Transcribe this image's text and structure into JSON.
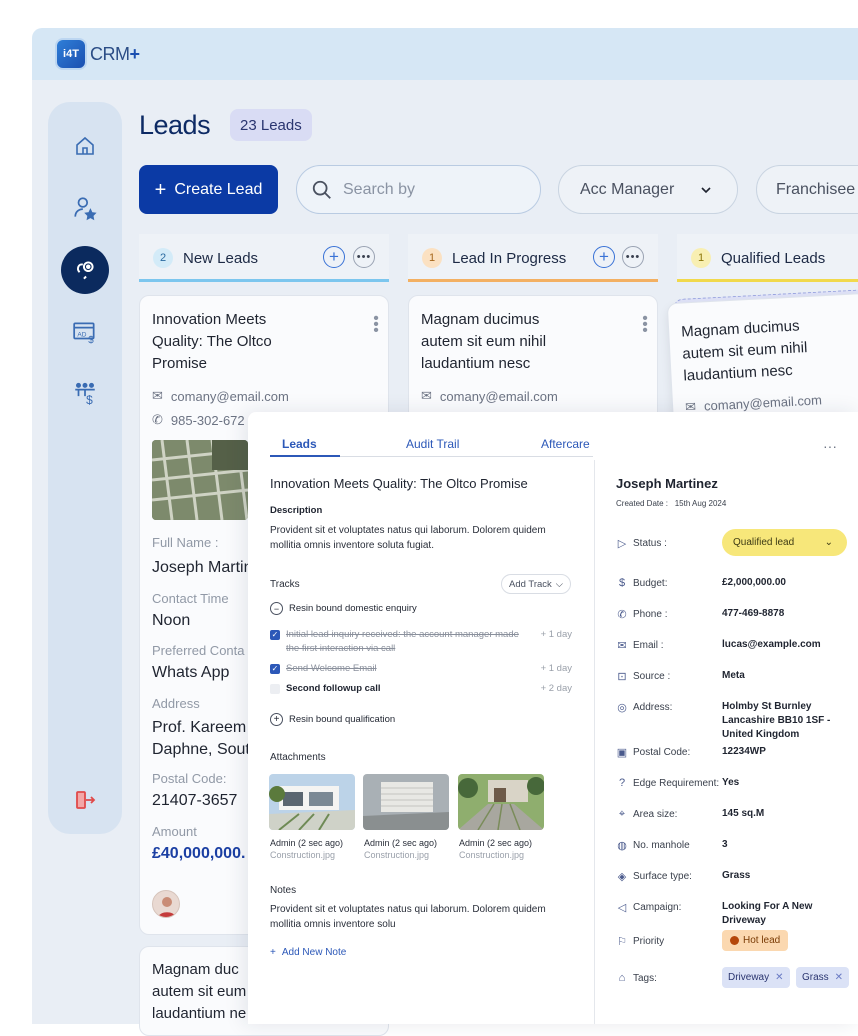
{
  "app": {
    "logo_text": "i4T",
    "name": "CRM",
    "plus": "+"
  },
  "sidebar": {
    "items": [
      "home-icon",
      "user-star-icon",
      "leads-icon",
      "ads-dollar-icon",
      "franchise-dollar-icon"
    ],
    "logout": "logout-icon"
  },
  "header": {
    "title": "Leads",
    "badge": "23 Leads"
  },
  "toolbar": {
    "create_label": "Create Lead",
    "search_placeholder": "Search by",
    "acc_manager": "Acc Manager",
    "franchisee": "Franchisee"
  },
  "columns": [
    {
      "count": "2",
      "title": "New Leads",
      "color": "#7cc6ee"
    },
    {
      "count": "1",
      "title": "Lead In Progress",
      "color": "#f3b062"
    },
    {
      "count": "1",
      "title": "Qualified Leads",
      "color": "#f1d94c"
    }
  ],
  "cards": {
    "new_1": {
      "title_lines": [
        "Innovation Meets",
        "Quality: The Oltco",
        "Promise"
      ],
      "email": "comany@email.com",
      "phone": "985-302-672",
      "full_name_label": "Full Name :",
      "full_name": "Joseph Martin",
      "contact_time_label": "Contact Time",
      "contact_time": "Noon",
      "preferred_label": "Preferred Conta",
      "preferred": "Whats App",
      "address_label": "Address",
      "address_lines": [
        "Prof. Kareem",
        "Daphne, Sout"
      ],
      "postal_label": "Postal Code:",
      "postal": "21407-3657",
      "amount_label": "Amount",
      "amount": "£40,000,000."
    },
    "new_2": {
      "title_lines": [
        "Magnam duc",
        "autem sit eum",
        "laudantium ne"
      ]
    },
    "progress_1": {
      "title_lines": [
        "Magnam ducimus",
        "autem sit eum nihil",
        "laudantium nesc"
      ],
      "email": "comany@email.com"
    },
    "qualified_1": {
      "title_lines": [
        "Magnam ducimus",
        "autem sit eum nihil",
        "laudantium nesc"
      ],
      "email": "comany@email.com"
    }
  },
  "panel": {
    "tabs": [
      "Leads",
      "Audit Trail",
      "Aftercare"
    ],
    "more": "···",
    "title": "Innovation Meets Quality: The Oltco Promise",
    "description_label": "Description",
    "description": "Provident sit et voluptates natus qui laborum. Dolorem quidem mollitia omnis inventore soluta fugiat.",
    "tracks_label": "Tracks",
    "add_track": "Add Track",
    "tracks": [
      {
        "label": "Resin bound domestic enquiry",
        "type": "group-open"
      },
      {
        "label": "Initial lead inquiry received: the account manager made the first interaction via call",
        "days": "+ 1 day",
        "type": "done"
      },
      {
        "label": "Send Welcome Email",
        "days": "+ 1 day",
        "type": "done"
      },
      {
        "label": "Second followup call",
        "days": "+ 2 day",
        "type": "todo"
      },
      {
        "label": "Resin bound qualification",
        "type": "group-closed"
      }
    ],
    "attachments_label": "Attachments",
    "attachments": [
      {
        "author": "Admin (2 sec ago)",
        "file": "Construction.jpg"
      },
      {
        "author": "Admin (2 sec ago)",
        "file": "Construction.jpg"
      },
      {
        "author": "Admin (2 sec ago)",
        "file": "Construction.jpg"
      }
    ],
    "notes_label": "Notes",
    "notes": "Provident sit et voluptates natus qui laborum. Dolorem quidem mollitia omnis inventore solu",
    "add_note": "Add New Note"
  },
  "details": {
    "name": "Joseph Martinez",
    "created": "Created Date :   15th Aug 2024",
    "status_label": "Status :",
    "status": "Qualified lead",
    "fields": [
      {
        "icon": "flag-icon",
        "label": "Budget:",
        "value": "£2,000,000.00"
      },
      {
        "icon": "phone-icon",
        "label": "Phone :",
        "value": "477-469-8878"
      },
      {
        "icon": "mail-icon",
        "label": "Email :",
        "value": "lucas@example.com"
      },
      {
        "icon": "source-icon",
        "label": "Source :",
        "value": "Meta"
      },
      {
        "icon": "location-icon",
        "label": "Address:",
        "value": "Holmby St Burnley Lancashire BB10 1SF - United Kingdom"
      },
      {
        "icon": "postal-icon",
        "label": "Postal Code:",
        "value": "12234WP"
      },
      {
        "icon": "question-icon",
        "label": "Edge Requirement:",
        "value": "Yes"
      },
      {
        "icon": "area-icon",
        "label": "Area size:",
        "value": "145 sq.M"
      },
      {
        "icon": "manhole-icon",
        "label": "No. manhole",
        "value": "3"
      },
      {
        "icon": "layers-icon",
        "label": "Surface type:",
        "value": "Grass"
      },
      {
        "icon": "megaphone-icon",
        "label": "Campaign:",
        "value": "Looking For A New Driveway"
      }
    ],
    "priority_label": "Priority",
    "priority": "Hot lead",
    "tags_label": "Tags:",
    "tags": [
      "Driveway",
      "Grass"
    ]
  }
}
